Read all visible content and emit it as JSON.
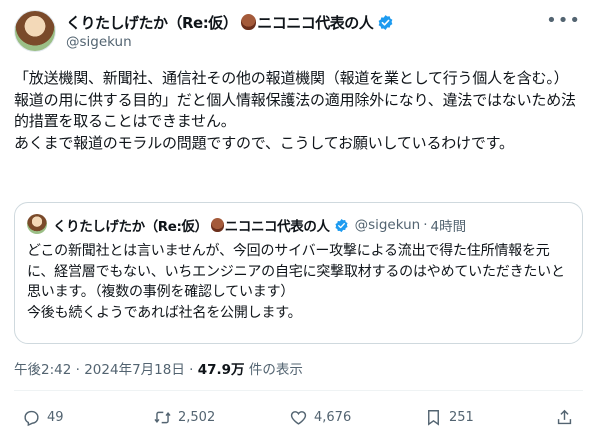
{
  "tweet": {
    "author_name": "くりたしげたか（Re:仮）",
    "author_suffix": "ニコニコ代表の人",
    "handle": "@sigekun",
    "more_label": "•••",
    "text": "「放送機関、新聞社、通信社その他の報道機関（報道を業として行う個人を含む。）　報道の用に供する目的」だと個人情報保護法の適用除外になり、違法ではないため法的措置を取ることはできません。\nあくまで報道のモラルの問題ですので、こうしてお願いしているわけです。",
    "quote": {
      "author_name": "くりたしげたか（Re:仮）",
      "author_suffix": "ニコニコ代表の人",
      "handle": "@sigekun",
      "separator": "·",
      "time": "4時間",
      "text": "どこの新聞社とは言いませんが、今回のサイバー攻撃による流出で得た住所情報を元に、経営層でもない、いちエンジニアの自宅に突撃取材するのはやめていただきたいと思います。（複数の事例を確認しています）\n今後も続くようであれば社名を公開します。"
    },
    "meta": {
      "time": "午後2:42",
      "date": "2024年7月18日",
      "dot": "·",
      "views_count": "47.9万",
      "views_label": "件の表示"
    },
    "actions": {
      "replies": "49",
      "retweets": "2,502",
      "likes": "4,676",
      "bookmarks": "251"
    }
  },
  "icons": {
    "verified": "verified-badge-icon",
    "reply": "reply-icon",
    "retweet": "retweet-icon",
    "like": "heart-icon",
    "bookmark": "bookmark-icon",
    "share": "share-icon"
  },
  "colors": {
    "text": "#0f1419",
    "secondary": "#536471",
    "verified": "#1d9bf0",
    "border": "#cfd9de"
  }
}
